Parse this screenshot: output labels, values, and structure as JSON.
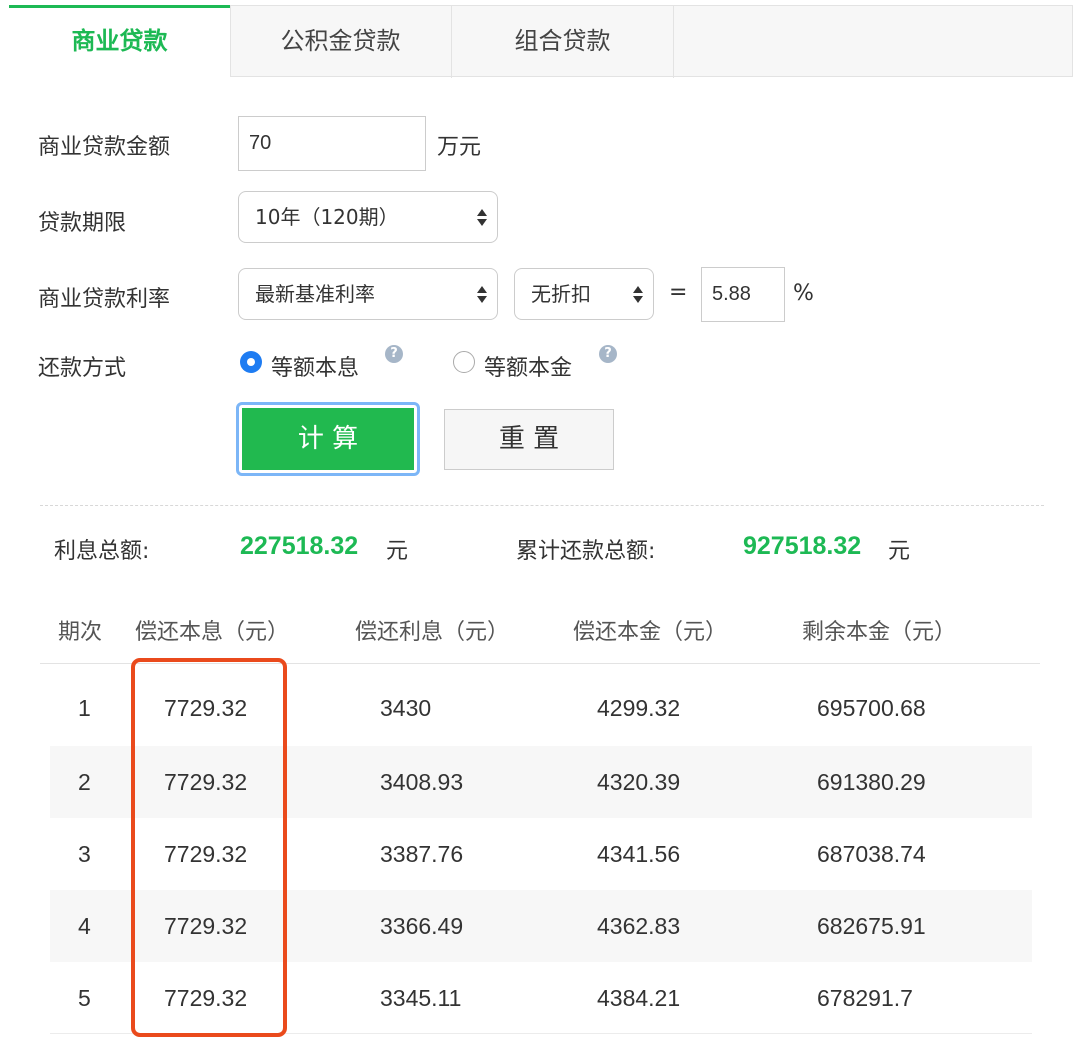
{
  "tabs": [
    {
      "label": "商业贷款"
    },
    {
      "label": "公积金贷款"
    },
    {
      "label": "组合贷款"
    }
  ],
  "form": {
    "amount_label": "商业贷款金额",
    "amount_value": "70",
    "amount_unit": "万元",
    "term_label": "贷款期限",
    "term_value": "10年（120期）",
    "rate_label": "商业贷款利率",
    "rate_type": "最新基准利率",
    "discount": "无折扣",
    "equals": "=",
    "rate_value": "5.88",
    "rate_unit": "%",
    "method_label": "还款方式",
    "method_1": "等额本息",
    "method_2": "等额本金",
    "calc_label": "计 算",
    "reset_label": "重 置"
  },
  "summary": {
    "interest_label": "利息总额:",
    "interest_value": "227518.32",
    "interest_unit": "元",
    "total_label": "累计还款总额:",
    "total_value": "927518.32",
    "total_unit": "元"
  },
  "table": {
    "headers": [
      "期次",
      "偿还本息（元）",
      "偿还利息（元）",
      "偿还本金（元）",
      "剩余本金（元）"
    ],
    "rows": [
      [
        "1",
        "7729.32",
        "3430",
        "4299.32",
        "695700.68"
      ],
      [
        "2",
        "7729.32",
        "3408.93",
        "4320.39",
        "691380.29"
      ],
      [
        "3",
        "7729.32",
        "3387.76",
        "4341.56",
        "687038.74"
      ],
      [
        "4",
        "7729.32",
        "3366.49",
        "4362.83",
        "682675.91"
      ],
      [
        "5",
        "7729.32",
        "3345.11",
        "4384.21",
        "678291.7"
      ]
    ]
  },
  "colors": {
    "accent": "#1db954",
    "highlight": "#ea4a1c",
    "radio": "#1e7cf2"
  }
}
